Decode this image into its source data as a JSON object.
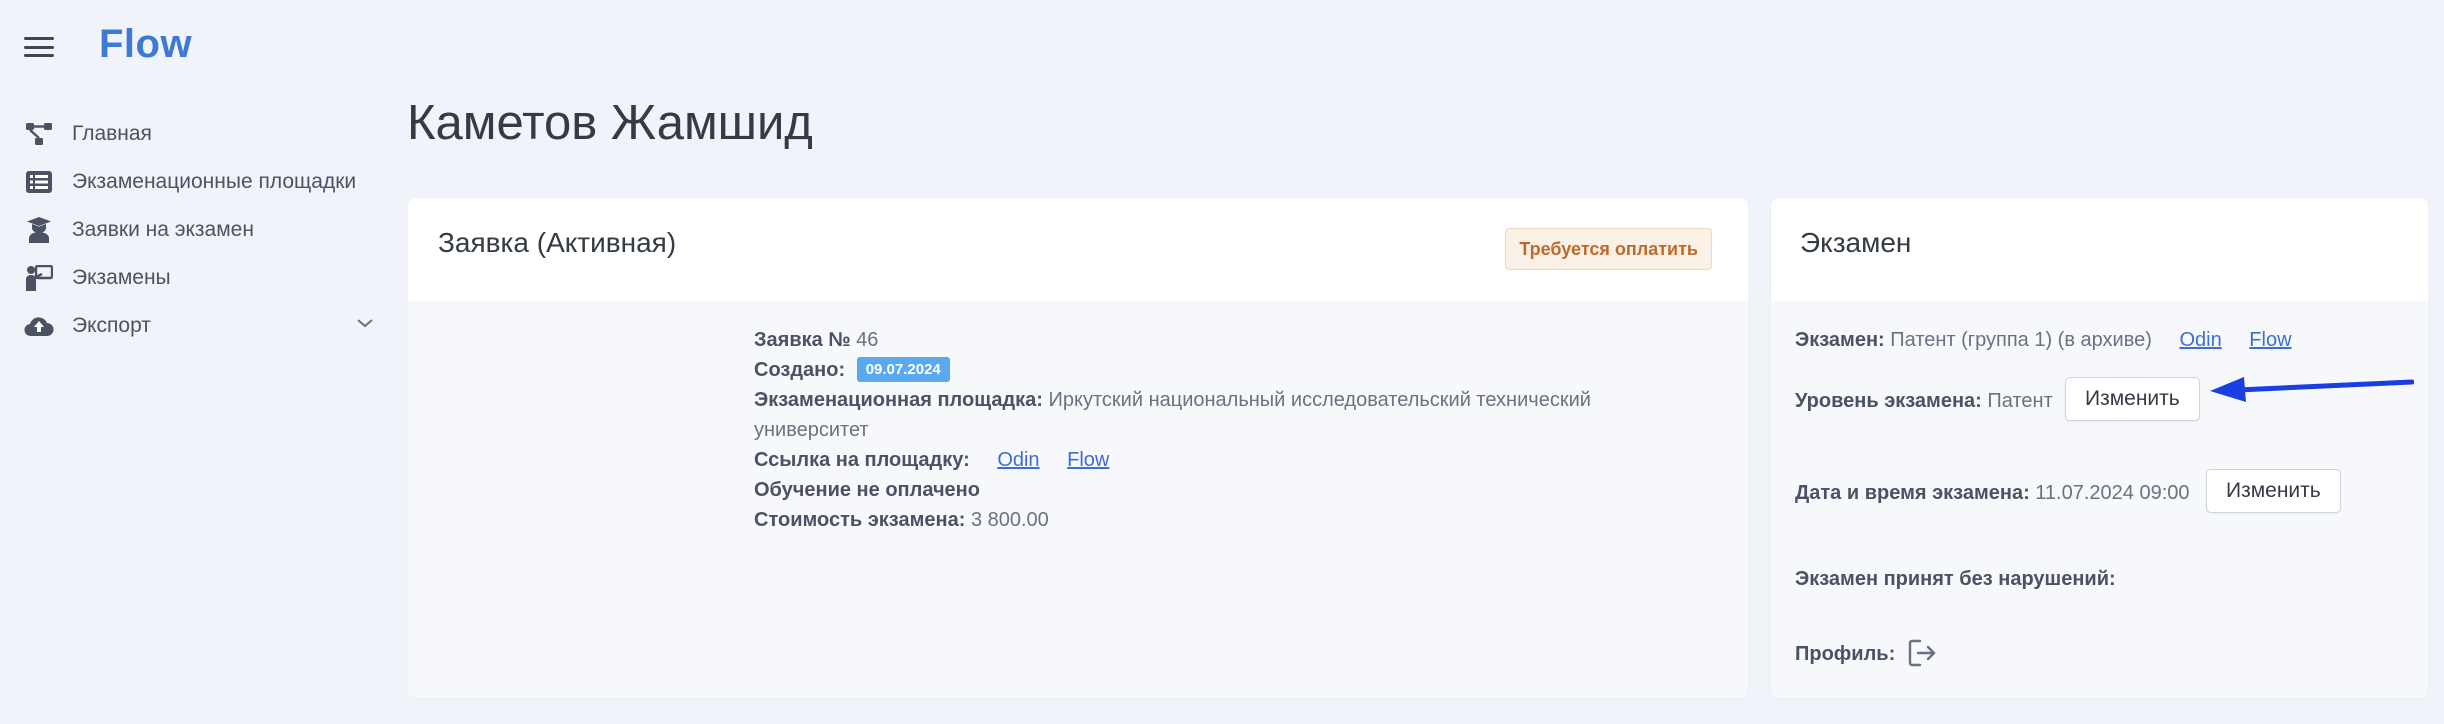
{
  "app": {
    "logo": "Flow"
  },
  "sidebar": {
    "items": [
      {
        "label": "Главная",
        "icon": "network-icon"
      },
      {
        "label": "Экзаменационные площадки",
        "icon": "list-icon"
      },
      {
        "label": "Заявки на экзамен",
        "icon": "student-icon"
      },
      {
        "label": "Экзамены",
        "icon": "teacher-board-icon"
      },
      {
        "label": "Экспорт",
        "icon": "cloud-upload-icon",
        "expandable": true
      }
    ]
  },
  "page": {
    "title": "Каметов Жамшид"
  },
  "application": {
    "title": "Заявка (Активная)",
    "status_badge": "Требуется оплатить",
    "number_label": "Заявка №",
    "number_value": "46",
    "created_label": "Создано:",
    "created_value": "09.07.2024",
    "venue_label": "Экзаменационная площадка:",
    "venue_value": "Иркутский национальный исследовательский технический университет",
    "link_label": "Ссылка на площадку:",
    "link_1": "Odin",
    "link_2": "Flow",
    "training_status": "Обучение не оплачено",
    "cost_label": "Стоимость экзамена:",
    "cost_value": "3 800.00"
  },
  "exam": {
    "title": "Экзамен",
    "exam_label": "Экзамен:",
    "exam_value": "Патент (группа 1) (в архиве)",
    "link_1": "Odin",
    "link_2": "Flow",
    "level_label": "Уровень экзамена:",
    "level_value": "Патент",
    "level_button": "Изменить",
    "datetime_label": "Дата и время экзамена:",
    "datetime_value": "11.07.2024 09:00",
    "datetime_button": "Изменить",
    "violations_label": "Экзамен принят без нарушений:",
    "profile_label": "Профиль:"
  },
  "colors": {
    "accent": "#3d7ad6",
    "annotation_arrow": "#1a3fe0",
    "warning_badge_bg": "#fbf0e6",
    "warning_badge_text": "#bf6a2b",
    "date_badge_bg": "#5aa9f0"
  }
}
